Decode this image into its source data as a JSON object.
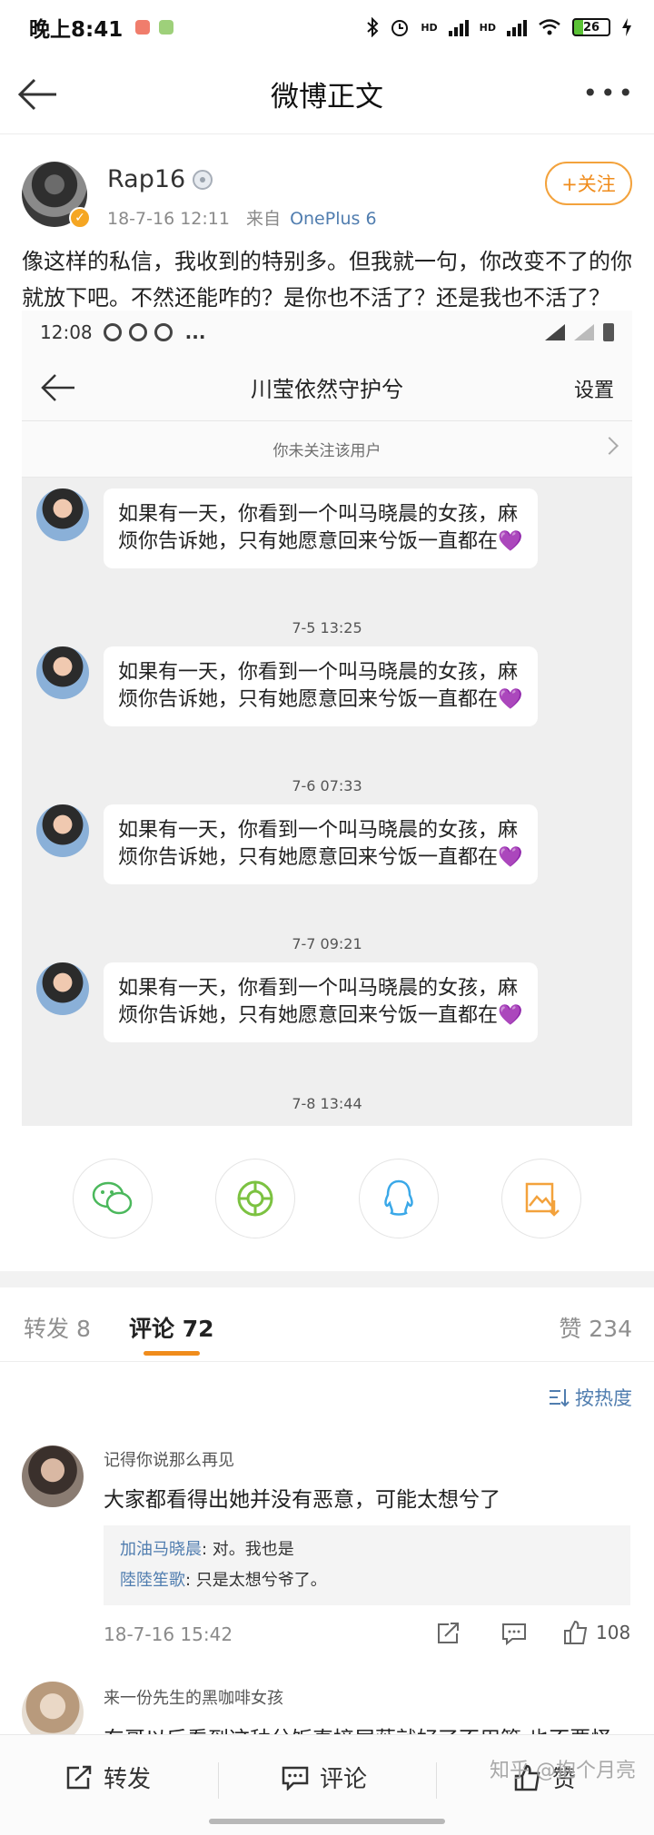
{
  "status_bar": {
    "time": "晚上8:41",
    "network_1": "HD",
    "network_2": "HD",
    "battery": "26"
  },
  "nav": {
    "title": "微博正文"
  },
  "post": {
    "username": "Rap16",
    "timestamp": "18-7-16 12:11",
    "source_label": "来自",
    "device": "OnePlus 6",
    "follow_label": "+关注",
    "text": "像这样的私信，我收到的特别多。但我就一句，你改变不了的你就放下吧。不然还能咋的？是你也不活了？还是我也不活了？"
  },
  "embedded_screenshot": {
    "status_time": "12:08",
    "status_more": "...",
    "title": "川莹依然守护兮",
    "settings": "设置",
    "notice": "你未关注该用户",
    "messages": [
      {
        "text": "如果有一天，你看到一个叫马晓晨的女孩，麻烦你告诉她，只有她愿意回来兮饭一直都在",
        "heart": "💜"
      },
      {
        "time": "7-5 13:25",
        "text": "如果有一天，你看到一个叫马晓晨的女孩，麻烦你告诉她，只有她愿意回来兮饭一直都在",
        "heart": "💜"
      },
      {
        "time": "7-6 07:33",
        "text": "如果有一天，你看到一个叫马晓晨的女孩，麻烦你告诉她，只有她愿意回来兮饭一直都在",
        "heart": "💜"
      },
      {
        "time": "7-7 09:21",
        "text": "如果有一天，你看到一个叫马晓晨的女孩，麻烦你告诉她，只有她愿意回来兮饭一直都在",
        "heart": "💜"
      },
      {
        "time": "7-8 13:44"
      }
    ]
  },
  "share_buttons": [
    {
      "icon": "wechat-icon",
      "color": "#4bb85c"
    },
    {
      "icon": "moments-icon",
      "color": "#7cc241"
    },
    {
      "icon": "qq-icon",
      "color": "#3aa8e8"
    },
    {
      "icon": "save-image-icon",
      "color": "#f3a23c"
    }
  ],
  "tabs": {
    "repost": "转发 8",
    "comments": "评论 72",
    "likes": "赞 234"
  },
  "sort_label": "按热度",
  "comments": [
    {
      "name": "记得你说那么再见",
      "text": "大家都看得出她并没有恶意，可能太想兮了",
      "replies": [
        {
          "name": "加油马晓晨",
          "text": ": 对。我也是"
        },
        {
          "name": "陸陸笙歌",
          "text": ": 只是太想兮爷了。"
        }
      ],
      "date": "18-7-16 15:42",
      "likes": "108"
    },
    {
      "name": "来一份先生的黑咖啡女孩",
      "text": "东哥以后看到这种兮饭直接屏蔽就好了不用管 也不要怪"
    }
  ],
  "bottom_bar": {
    "repost": "转发",
    "comment": "评论",
    "like": "赞"
  },
  "watermark": "知乎 @抱个月亮",
  "colors": {
    "accent_orange": "#f08c1c",
    "link_blue": "#507daf"
  }
}
